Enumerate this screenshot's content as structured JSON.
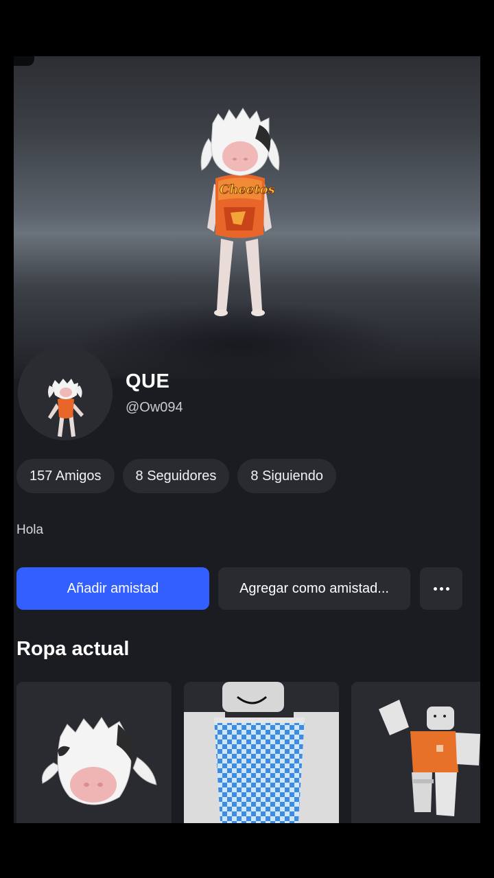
{
  "profile": {
    "display_name": "QUE",
    "username": "@Ow094",
    "bio": "Hola"
  },
  "stats": {
    "friends": "157 Amigos",
    "followers": "8 Seguidores",
    "following": "8 Siguiendo"
  },
  "actions": {
    "add_friend": "Añadir amistad",
    "request_friend": "Agregar como amistad...",
    "more": "more-options"
  },
  "outfit": {
    "section_title": "Ropa actual",
    "items": [
      {
        "icon": "cow-head-accessory-thumbnail"
      },
      {
        "icon": "checkered-shirt-thumbnail"
      },
      {
        "icon": "orange-shirt-avatar-thumbnail"
      }
    ]
  },
  "colors": {
    "accent": "#335fff",
    "surface": "#1b1c21",
    "pill": "#2a2b31"
  }
}
